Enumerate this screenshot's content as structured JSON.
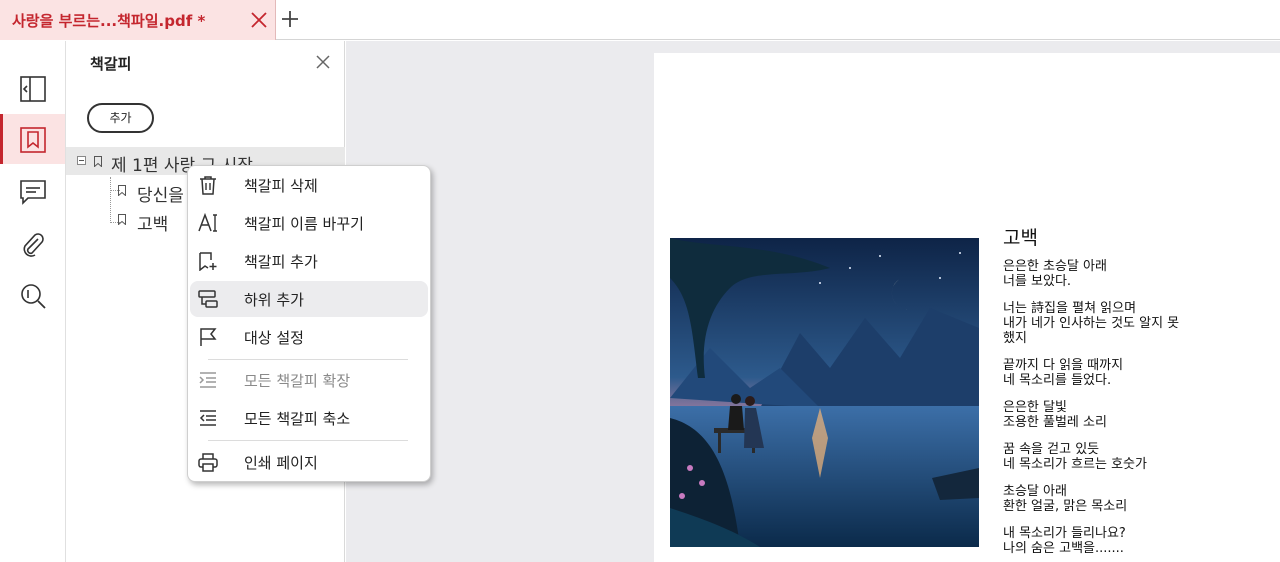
{
  "tab": {
    "title": "사랑을  부르는...책파일.pdf *"
  },
  "panel": {
    "title": "책갈피",
    "add_label": "추가",
    "tree": [
      {
        "label": "제 1편 사랑 그 시작"
      },
      {
        "label": "당신을"
      },
      {
        "label": "고백"
      }
    ]
  },
  "context_menu": {
    "items": [
      {
        "label": "책갈피 삭제",
        "icon": "trash-icon"
      },
      {
        "label": "책갈피 이름 바꾸기",
        "icon": "rename-icon"
      },
      {
        "label": "책갈피 추가",
        "icon": "bookmark-add-icon"
      },
      {
        "label": "하위 추가",
        "icon": "add-child-icon",
        "highlighted": true
      },
      {
        "label": "대상 설정",
        "icon": "flag-icon"
      },
      {
        "label": "모든 책갈피 확장",
        "icon": "expand-all-icon",
        "disabled": true
      },
      {
        "label": "모든 책갈피 축소",
        "icon": "collapse-all-icon"
      },
      {
        "label": "인쇄 페이지",
        "icon": "print-icon"
      }
    ]
  },
  "poem": {
    "title": "고백",
    "stanzas": [
      [
        "은은한 초승달 아래",
        "너를 보았다."
      ],
      [
        "너는 詩집을 펼쳐 읽으며",
        "내가 네가 인사하는 것도 알지 못",
        "했지"
      ],
      [
        "끝까지 다 읽을 때까지",
        "네 목소리를 들었다."
      ],
      [
        "은은한 달빛",
        "조용한 풀벌레 소리"
      ],
      [
        "꿈 속을 걷고 있듯",
        "네 목소리가 흐르는 호숫가"
      ],
      [
        "초승달 아래",
        "환한 얼굴, 맑은 목소리"
      ],
      [
        "내 목소리가 들리나요?",
        "나의 숨은 고백을......."
      ]
    ]
  },
  "colors": {
    "accent": "#c4262e",
    "tab_bg": "#fbe3e3",
    "doc_bg": "#ebebee"
  }
}
